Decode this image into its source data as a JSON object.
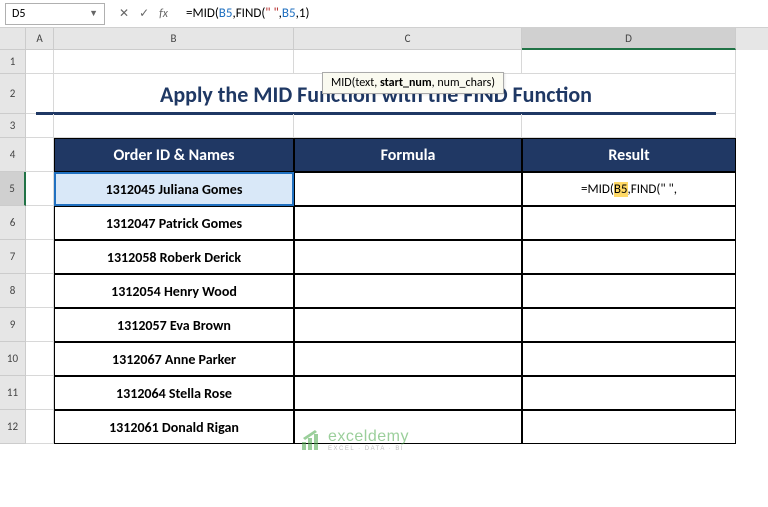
{
  "namebox": {
    "value": "D5"
  },
  "formula_bar": {
    "prefix": "=MID(",
    "ref1": "B5",
    "mid1": ",FIND(",
    "str": "\" \"",
    "mid2": ",",
    "ref2": "B5",
    "mid3": ",",
    "num": "1",
    "suffix": ")"
  },
  "tooltip": {
    "fn": "MID",
    "arg1": "text",
    "arg2": "start_num",
    "arg3": "num_chars"
  },
  "col_headers": [
    "A",
    "B",
    "C",
    "D"
  ],
  "row_headers": [
    "1",
    "2",
    "3",
    "4",
    "5",
    "6",
    "7",
    "8",
    "9",
    "10",
    "11",
    "12"
  ],
  "title": "Apply the MID Function with the FIND Function",
  "headers": {
    "b": "Order ID & Names",
    "c": "Formula",
    "d": "Result"
  },
  "data": {
    "b5": "1312045 Juliana Gomes",
    "b6": "1312047 Patrick Gomes",
    "b7": "1312058 Roberk Derick",
    "b8": "1312054 Henry Wood",
    "b9": "1312057 Eva Brown",
    "b10": "1312067 Anne Parker",
    "b11": "1312064 Stella Rose",
    "b12": "1312061 Donald Rigan"
  },
  "d5_parts": {
    "p1": "=MID(",
    "ref": "B5",
    "p2": ",FIND(\" \","
  },
  "watermark": {
    "main": "exceldemy",
    "sub": "EXCEL · DATA · BI"
  }
}
